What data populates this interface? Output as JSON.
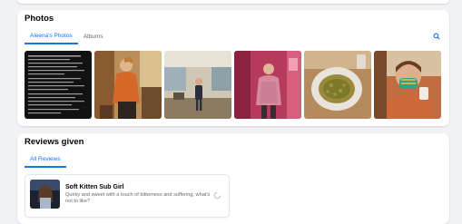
{
  "photos": {
    "title": "Photos",
    "tabs": [
      {
        "label": "Aleena's Photos",
        "active": true
      },
      {
        "label": "Albums",
        "active": false
      }
    ],
    "search_icon": "search-icon",
    "items": [
      {
        "subject": "document screenshot"
      },
      {
        "subject": "woman in orange"
      },
      {
        "subject": "woman in room"
      },
      {
        "subject": "woman in pink room"
      },
      {
        "subject": "plate of food"
      },
      {
        "subject": "woman with face mask"
      }
    ]
  },
  "reviews": {
    "title": "Reviews given",
    "tabs": [
      {
        "label": "All Reviews",
        "active": true
      }
    ],
    "items": [
      {
        "title": "Soft Kitten Sub Girl",
        "description": "Quirky and sweet with a touch of bitterness and suffering, what's not to like?"
      }
    ]
  },
  "colors": {
    "accent": "#1b74e4",
    "background": "#f0f2f5",
    "card": "#ffffff",
    "secondary_text": "#65676b"
  }
}
